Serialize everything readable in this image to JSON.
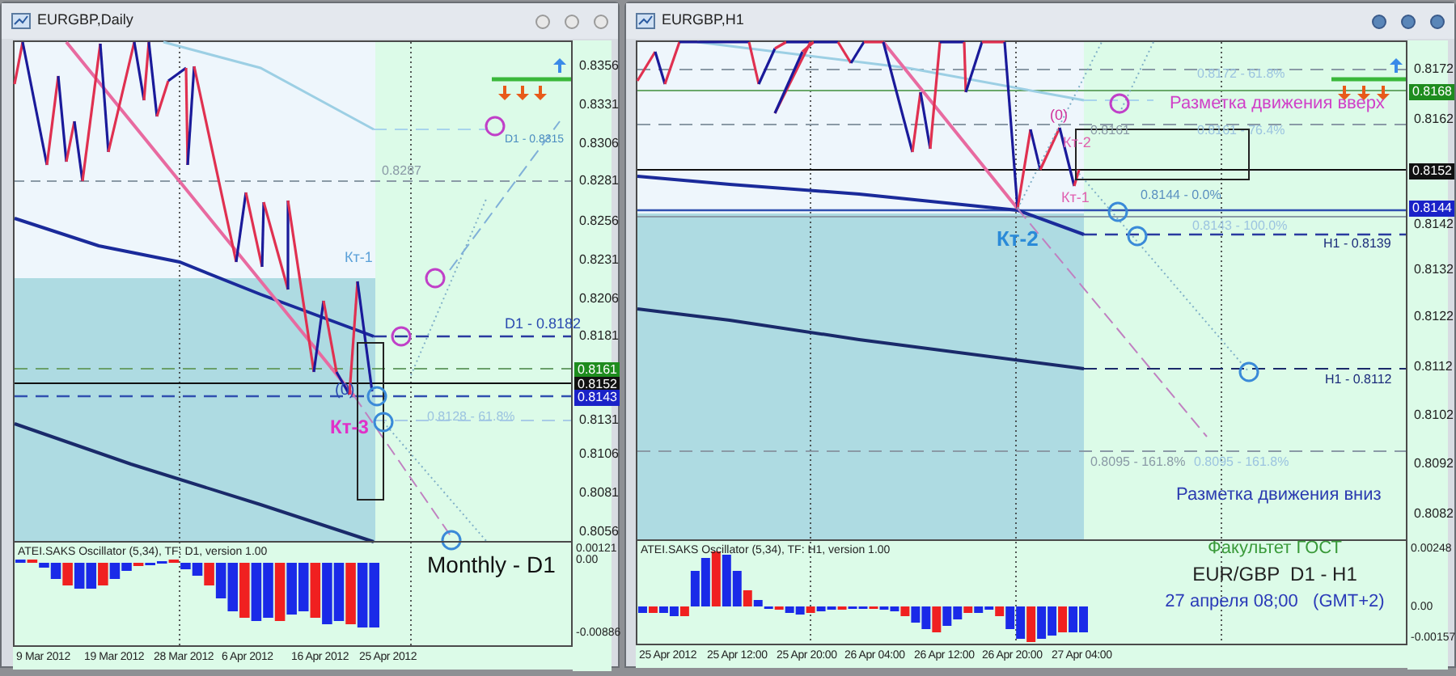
{
  "windows": [
    {
      "title": "EURGBP,Daily",
      "price_ticks": [
        "0.8356",
        "0.8331",
        "0.8306",
        "0.8281",
        "0.8256",
        "0.8231",
        "0.8206",
        "0.8181",
        "0.8131",
        "0.8106",
        "0.8081",
        "0.8056"
      ],
      "price_tags": [
        {
          "text": "0.8161",
          "color": "#1e8c1e"
        },
        {
          "text": "0.8152",
          "color": "#111111"
        },
        {
          "text": "0.8143",
          "color": "#1a22c8"
        }
      ],
      "annotations": [
        {
          "text": "D1 - 0.8315",
          "color": "#4a8cc0"
        },
        {
          "text": "0.8287",
          "color": "#8a9aa6"
        },
        {
          "text": "Кт-1",
          "color": "#5aa0d8"
        },
        {
          "text": "D1 - 0.8182",
          "color": "#2a4ab0"
        },
        {
          "text": "(0)",
          "color": "#2a4ab0"
        },
        {
          "text": "0.8128 - 61.8%",
          "color": "#9cc4e0"
        },
        {
          "text": "Кт-3",
          "color": "#e030c8"
        }
      ],
      "captions": [
        {
          "text": "Monthly - D1",
          "color": "#111111"
        }
      ],
      "oscillator": {
        "title": "ATEI.SAKS Oscillator (5,34), TF: D1, version 1.00",
        "ticks": [
          "0.00121",
          "0.00",
          "-0.00886"
        ]
      },
      "time_ticks": [
        "9 Mar 2012",
        "19 Mar 2012",
        "28 Mar 2012",
        "6 Apr 2012",
        "16 Apr 2012",
        "25 Apr 2012"
      ]
    },
    {
      "title": "EURGBP,H1",
      "price_ticks": [
        "0.8172",
        "0.8162",
        "0.8142",
        "0.8132",
        "0.8122",
        "0.8112",
        "0.8102",
        "0.8092",
        "0.8082"
      ],
      "price_tags": [
        {
          "text": "0.8168",
          "color": "#1e8c1e"
        },
        {
          "text": "0.8152",
          "color": "#111111"
        },
        {
          "text": "0.8144",
          "color": "#1a22c8"
        }
      ],
      "annotations": [
        {
          "text": "0.8172 - 61.8%",
          "color": "#9cc4e0"
        },
        {
          "text": "Разметка движения вверх",
          "color": "#d040c8"
        },
        {
          "text": "(0)",
          "color": "#d0309a"
        },
        {
          "text": "0.8161",
          "color": "#8a9aa6"
        },
        {
          "text": "0.8161 - 76.4%",
          "color": "#9cc4e0"
        },
        {
          "text": "Кт-2",
          "color": "#e060b0"
        },
        {
          "text": "Кт-1",
          "color": "#e060b0"
        },
        {
          "text": "0.8144 - 0.0%",
          "color": "#5a90c0"
        },
        {
          "text": "0.8143 - 100.0%",
          "color": "#9cc4e0"
        },
        {
          "text": "Кт-2",
          "color": "#2a8ad8"
        },
        {
          "text": "H1 - 0.8139",
          "color": "#1a2a7a"
        },
        {
          "text": "H1 - 0.8112",
          "color": "#1a2a7a"
        },
        {
          "text": "0.8095 - 161.8%",
          "color": "#8a9aa6"
        },
        {
          "text": "0.8095 - 161.8%",
          "color": "#9cc4e0"
        },
        {
          "text": "Разметка движения вниз",
          "color": "#2a3ab0"
        }
      ],
      "captions": [
        {
          "text": "Факультет ГОСТ",
          "color": "#3a9a3a"
        },
        {
          "text": "EUR/GBP  D1 - H1",
          "color": "#222222"
        },
        {
          "text": "27 апреля 08;00   (GMT+2)",
          "color": "#2a3ab8"
        }
      ],
      "oscillator": {
        "title": "ATEI.SAKS Oscillator (5,34), TF: H1, version 1.00",
        "ticks": [
          "0.00248",
          "0.00",
          "-0.00157"
        ]
      },
      "time_ticks": [
        "25 Apr 2012",
        "25 Apr 12:00",
        "25 Apr 20:00",
        "26 Apr 04:00",
        "26 Apr 12:00",
        "26 Apr 20:00",
        "27 Apr 04:00"
      ]
    }
  ]
}
